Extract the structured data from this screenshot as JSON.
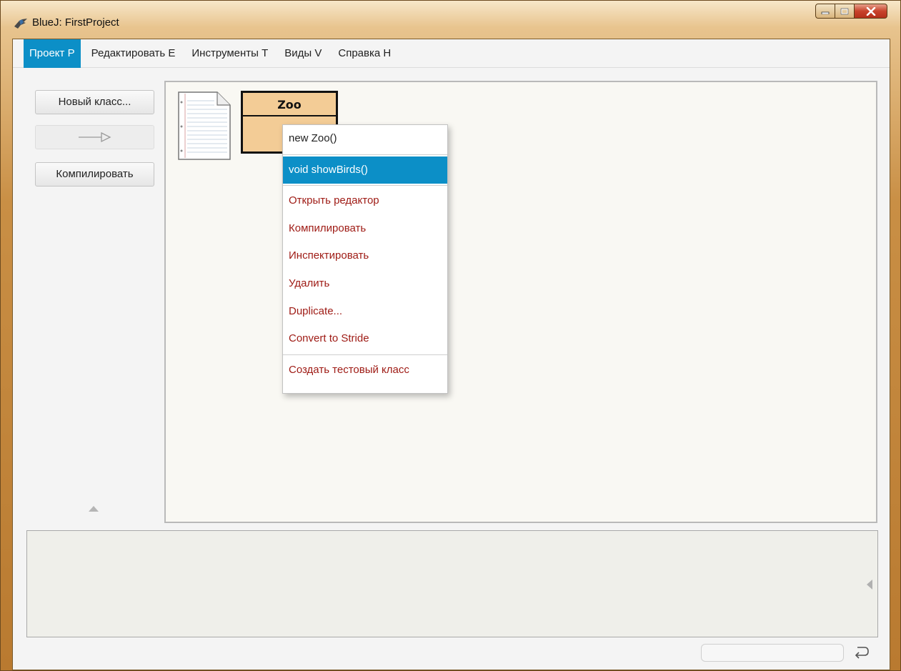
{
  "window": {
    "title": "BlueJ:  FirstProject"
  },
  "menubar": {
    "items": [
      {
        "label": "Проект P",
        "active": true
      },
      {
        "label": "Редактировать E"
      },
      {
        "label": "Инструменты T"
      },
      {
        "label": "Виды V"
      },
      {
        "label": "Справка H"
      }
    ]
  },
  "toolbar": {
    "new_class_label": "Новый класс...",
    "compile_label": "Компилировать"
  },
  "diagram": {
    "class_name": "Zoo"
  },
  "context_menu": {
    "items": [
      "new Zoo()",
      "void showBirds()",
      "Открыть редактор",
      "Компилировать",
      "Инспектировать",
      "Удалить",
      "Duplicate...",
      "Convert to Stride",
      "Создать тестовый класс"
    ]
  },
  "colors": {
    "accent": "#0c8fc7",
    "class_fill": "#f3cc96",
    "menu_action_text": "#9e1a14"
  },
  "icons": {
    "app": "bluej-bird-icon",
    "readme": "document-icon",
    "arrow": "inheritance-arrow-icon",
    "return": "return-arrow-icon"
  }
}
